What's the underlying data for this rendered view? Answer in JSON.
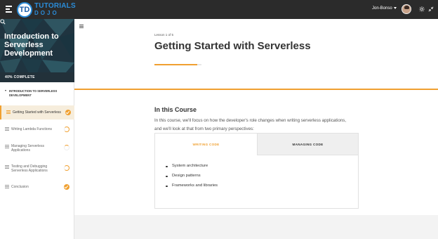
{
  "header": {
    "logo_mark": "TD",
    "logo_line1": "TUTORIALS",
    "logo_line2": "DOJO",
    "user_name": "Jon-Bonso",
    "icons": [
      "hamburger-icon",
      "chevron-down-icon",
      "sun-icon",
      "collapse-icon"
    ]
  },
  "sidebar": {
    "course_title": "Introduction to Serverless Development",
    "progress_text": "40% COMPLETE",
    "progress_percent": 40,
    "section_title": "INTRODUCTION TO SERVERLESS DEVELOPMENT",
    "lessons": [
      {
        "label": "Getting Started with Serverless",
        "status": "complete",
        "active": true
      },
      {
        "label": "Writing Lambda Functions",
        "status": "in-progress",
        "active": false
      },
      {
        "label": "Managing Serverless Applications",
        "status": "in-progress",
        "active": false
      },
      {
        "label": "Testing and Debugging Serverless Applications",
        "status": "in-progress",
        "active": false
      },
      {
        "label": "Conclusion",
        "status": "complete",
        "active": false
      }
    ]
  },
  "main": {
    "lesson_counter": "Lesson 1 of 5",
    "title": "Getting Started with Serverless",
    "section_heading": "In this Course",
    "intro_text": "In this course, we'll focus on how the developer's role changes when writing serverless applications, and we'll look at that from two primary perspectives:",
    "tabs": [
      {
        "label": "WRITING CODE",
        "active": true
      },
      {
        "label": "MANAGING CODE",
        "active": false
      }
    ],
    "bullets": [
      "System architecture",
      "Design patterns",
      "Frameworks and libraries"
    ]
  },
  "colors": {
    "accent": "#f0a030",
    "topbar": "#2b2b2b",
    "logo_blue": "#2b8cd8"
  }
}
